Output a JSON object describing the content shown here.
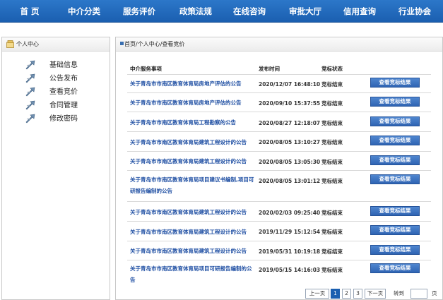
{
  "nav": {
    "items": [
      "首 页",
      "中介分类",
      "服务评价",
      "政策法规",
      "在线咨询",
      "审批大厅",
      "信用查询",
      "行业协会"
    ]
  },
  "sidebar": {
    "title": "个人中心",
    "items": [
      {
        "label": "基础信息",
        "icon": "arrow-icon"
      },
      {
        "label": "公告发布",
        "icon": "arrow-icon"
      },
      {
        "label": "查看竞价",
        "icon": "arrow-icon"
      },
      {
        "label": "合同管理",
        "icon": "arrow-icon"
      },
      {
        "label": "修改密码",
        "icon": "arrow-icon"
      }
    ]
  },
  "breadcrumb": "首页/个人中心/查看竞价",
  "table": {
    "headers": [
      "中介服务事项",
      "发布时间",
      "竞标状态"
    ],
    "rows": [
      {
        "title": "关于青岛市市南区教育体育局房地产评估的公告",
        "time": "2020/12/07 16:48:10",
        "status": "竞标结束",
        "button": "查看竞标结果"
      },
      {
        "title": "关于青岛市市南区教育体育局房地产评估的公告",
        "time": "2020/09/10 15:37:55",
        "status": "竞标结束",
        "button": "查看竞标结果"
      },
      {
        "title": "关于青岛市市南区教育体育局工程勘察的公告",
        "time": "2020/08/27 12:18:07",
        "status": "竞标结束",
        "button": "查看竞标结果"
      },
      {
        "title": "关于青岛市市南区教育体育局建筑工程设计的公告",
        "time": "2020/08/05 13:10:27",
        "status": "竞标结束",
        "button": "查看竞标结果"
      },
      {
        "title": "关于青岛市市南区教育体育局建筑工程设计的公告",
        "time": "2020/08/05 13:05:30",
        "status": "竞标结束",
        "button": "查看竞标结果"
      },
      {
        "title": "关于青岛市市南区教育体育局项目建议书编制,项目可研报告编制的公告",
        "time": "2020/08/05 13:01:12",
        "status": "竞标结束",
        "button": "查看竞标结果"
      },
      {
        "title": "关于青岛市市南区教育体育局建筑工程设计的公告",
        "time": "2020/02/03 09:25:40",
        "status": "竞标结束",
        "button": "查看竞标结果"
      },
      {
        "title": "关于青岛市市南区教育体育局建筑工程设计的公告",
        "time": "2019/11/29 15:12:54",
        "status": "竞标结束",
        "button": "查看竞标结果"
      },
      {
        "title": "关于青岛市市南区教育体育局建筑工程设计的公告",
        "time": "2019/05/31 10:19:18",
        "status": "竞标结束",
        "button": "查看竞标结果"
      },
      {
        "title": "关于青岛市市南区教育体育局项目可研报告编制的公告",
        "time": "2019/05/15 14:16:03",
        "status": "竞标结束",
        "button": "查看竞标结果"
      }
    ]
  },
  "pager": {
    "prev": "上一页",
    "pages": [
      "1",
      "2",
      "3"
    ],
    "current": "1",
    "next": "下一页",
    "goto_label": "转到",
    "page_unit": "页",
    "input_value": ""
  }
}
